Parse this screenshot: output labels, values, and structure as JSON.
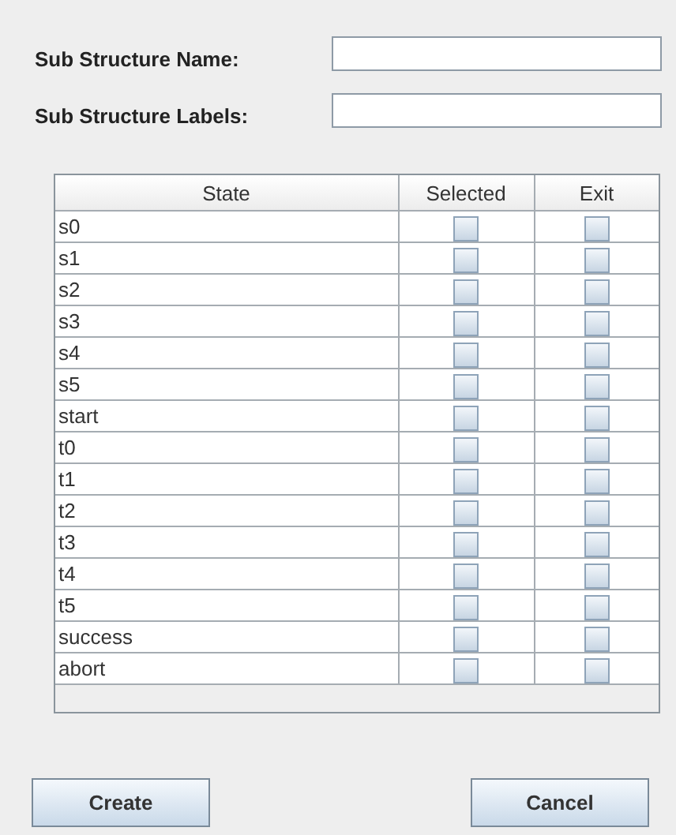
{
  "form": {
    "fields": [
      {
        "label": "Sub Structure Name:"
      },
      {
        "label": "Sub Structure Labels:"
      }
    ]
  },
  "table": {
    "columns": [
      "State",
      "Selected",
      "Exit"
    ],
    "rows": [
      {
        "state": "s0",
        "selected": false,
        "exit": false
      },
      {
        "state": "s1",
        "selected": false,
        "exit": false
      },
      {
        "state": "s2",
        "selected": false,
        "exit": false
      },
      {
        "state": "s3",
        "selected": false,
        "exit": false
      },
      {
        "state": "s4",
        "selected": false,
        "exit": false
      },
      {
        "state": "s5",
        "selected": false,
        "exit": false
      },
      {
        "state": "start",
        "selected": false,
        "exit": false
      },
      {
        "state": "t0",
        "selected": false,
        "exit": false
      },
      {
        "state": "t1",
        "selected": false,
        "exit": false
      },
      {
        "state": "t2",
        "selected": false,
        "exit": false
      },
      {
        "state": "t3",
        "selected": false,
        "exit": false
      },
      {
        "state": "t4",
        "selected": false,
        "exit": false
      },
      {
        "state": "t5",
        "selected": false,
        "exit": false
      },
      {
        "state": "success",
        "selected": false,
        "exit": false
      },
      {
        "state": "abort",
        "selected": false,
        "exit": false
      }
    ]
  },
  "buttons": [
    "Create",
    "Cancel"
  ]
}
